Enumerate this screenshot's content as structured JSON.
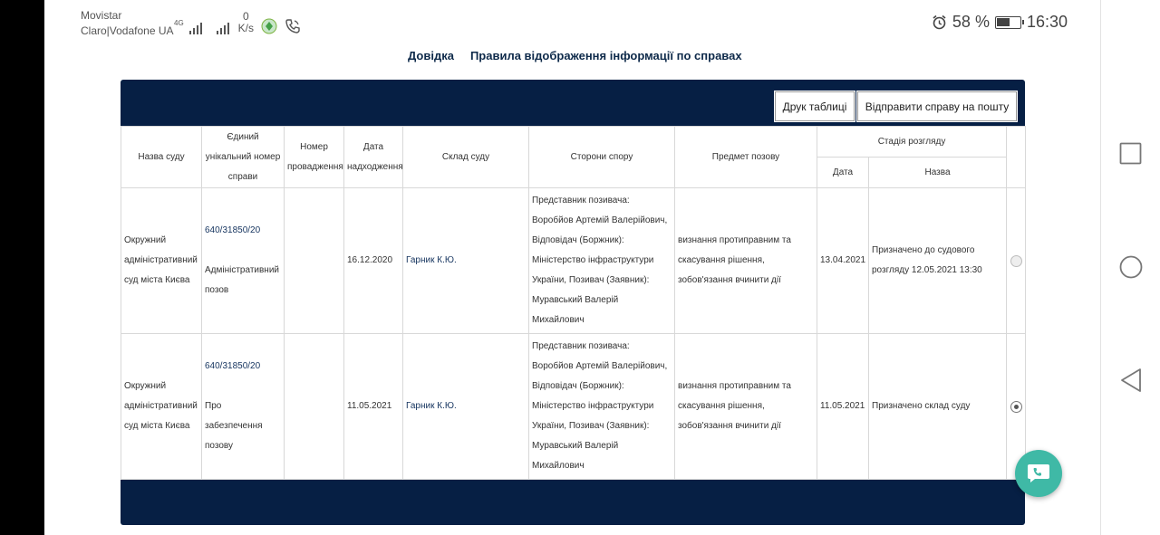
{
  "status_bar": {
    "carrier_1": "Movistar",
    "carrier_2": "Claro|Vodafone UA",
    "network_tag": "4G",
    "speed_value": "0",
    "speed_unit": "K/s",
    "battery_percent": "58 %",
    "battery_level": 0.58,
    "time": "16:30"
  },
  "top_links": {
    "help": "Довідка",
    "rules": "Правила відображення інформації по справах"
  },
  "toolbar": {
    "print_label": "Друк таблиці",
    "send_label": "Відправити справу на пошту"
  },
  "table": {
    "headers": {
      "court": "Назва суду",
      "case_number": "Єдиний унікальний номер справи",
      "proceeding": "Номер провадження",
      "date_received": "Дата надходження",
      "court_panel": "Склад суду",
      "parties": "Сторони спору",
      "subject": "Предмет позову",
      "stage": "Стадія розгляду",
      "stage_date": "Дата",
      "stage_name": "Назва"
    },
    "rows": [
      {
        "court": "Окружний адміністративний суд міста Києва",
        "case_number": "640/31850/20",
        "case_type": "Адміністративний позов",
        "proceeding": "",
        "date_received": "16.12.2020",
        "court_panel": "Гарник К.Ю.",
        "parties": "Представник позивача: Воробйов Артемій Валерійович, Відповідач (Боржник): Міністерство інфраструктури України, Позивач (Заявник): Муравський Валерій Михайлович",
        "subject": "визнання протиправним та скасування рішення, зобов'язання вчинити дії",
        "stage_date": "13.04.2021",
        "stage_name": "Призначено до судового розгляду 12.05.2021 13:30",
        "selected": false
      },
      {
        "court": "Окружний адміністративний суд міста Києва",
        "case_number": "640/31850/20",
        "case_type": "Про забезпечення позову",
        "proceeding": "",
        "date_received": "11.05.2021",
        "court_panel": "Гарник К.Ю.",
        "parties": "Представник позивача: Воробйов Артемій Валерійович, Відповідач (Боржник): Міністерство інфраструктури України, Позивач (Заявник): Муравський Валерій Михайлович",
        "subject": "визнання протиправним та скасування рішення, зобов'язання вчинити дії",
        "stage_date": "11.05.2021",
        "stage_name": "Призначено склад суду",
        "selected": true
      }
    ]
  },
  "colors": {
    "frame": "#061f44",
    "link": "#14335e",
    "chat_fab": "#3fb9a6"
  },
  "icons": {
    "alarm": "alarm-icon",
    "battery": "battery-icon",
    "chat": "chat-icon",
    "nav_recent": "square-icon",
    "nav_home": "circle-icon",
    "nav_back": "triangle-back-icon"
  }
}
